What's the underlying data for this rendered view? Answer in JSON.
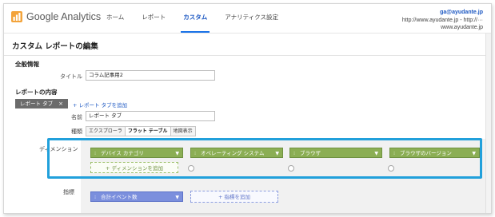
{
  "header": {
    "logo_text": "Google Analytics",
    "nav": [
      "ホーム",
      "レポート",
      "カスタム",
      "アナリティクス設定"
    ],
    "active_nav": "カスタム",
    "account_email": "ga@ayudante.jp",
    "account_url": "http://www.ayudante.jp - http://···",
    "account_property": "www.ayudante.jp"
  },
  "page": {
    "title": "カスタム レポートの編集"
  },
  "general": {
    "section_title": "全般情報",
    "title_label": "タイトル",
    "title_value": "コラム記事用2"
  },
  "report_content": {
    "section_title": "レポートの内容",
    "tab_chip": "レポート タブ",
    "tab_chip_close": "×",
    "add_tab": "+ レポート タブを追加",
    "name_label": "名前",
    "name_value": "レポート タブ",
    "type_label": "種類",
    "types": [
      "エクスプローラ",
      "フラット テーブル",
      "地図表示"
    ],
    "selected_type": "フラット テーブル",
    "dimension_label": "ディメンション",
    "dimensions": [
      "デバイス カテゴリ",
      "オペレーティング システム",
      "ブラウザ",
      "ブラウザのバージョン"
    ],
    "add_dimension": "+ ディメンションを追加",
    "metric_label": "指標",
    "metrics": [
      "合計イベント数"
    ],
    "add_metric": "+ 指標を追加"
  },
  "icons": {
    "grip": "⁝",
    "caret": "▼"
  },
  "colors": {
    "dimension_chip": "#8bae54",
    "metric_chip": "#7b8fdd",
    "highlight_border": "#21a0db",
    "active_nav": "#1a56c2"
  }
}
